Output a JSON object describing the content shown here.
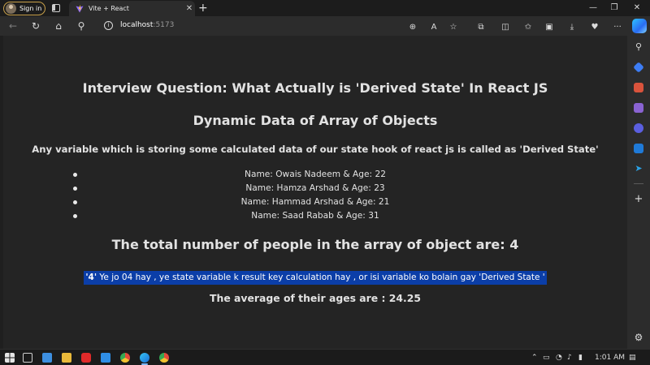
{
  "browser": {
    "signin_label": "Sign in",
    "tab_title": "Vite + React",
    "tab_close": "✕",
    "new_tab": "+",
    "window_controls": [
      "—",
      "❐",
      "✕"
    ],
    "url_host": "localhost",
    "url_port": ":5173",
    "more_menu": "···"
  },
  "page": {
    "heading1": "Interview Question: What Actually is 'Derived State' In React JS",
    "heading2": "Dynamic Data of Array of Objects",
    "heading3": "Any variable which is storing some calculated data of our state hook of react js is called as 'Derived State'",
    "people": [
      "Name: Owais Nadeem & Age: 22",
      "Name: Hamza Arshad & Age: 23",
      "Name: Hammad Arshad & Age: 21",
      "Name: Saad Rabab & Age: 31"
    ],
    "total_text": "The total number of people in the array of object are: 4",
    "derived_highlight": "'4'",
    "derived_text": " Ye jo 04 hay , ye state variable k result key calculation hay , or isi variable ko bolain gay 'Derived State '",
    "average_text": "The average of their ages are : 24.25"
  },
  "taskbar": {
    "time": "1:01 AM"
  },
  "colors": {
    "page_bg": "#242424",
    "highlight": "#0b3ea8",
    "signin_border": "#c9a14a"
  }
}
